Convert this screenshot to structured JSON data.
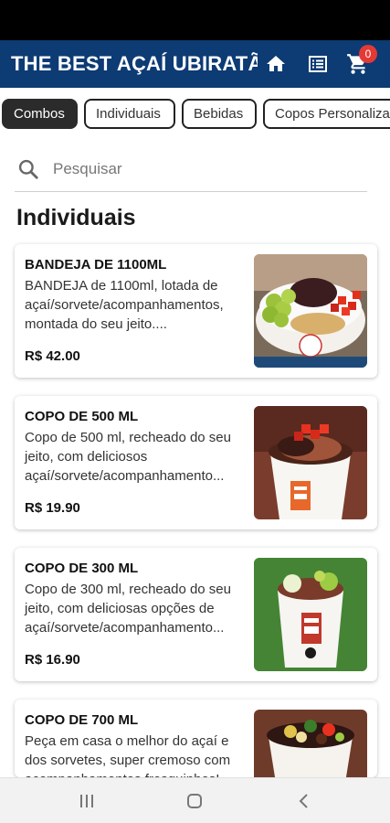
{
  "app": {
    "title": "THE BEST AÇAÍ UBIRATÃ"
  },
  "header": {
    "cart_count": "0"
  },
  "tabs": [
    {
      "label": "Combos",
      "active": true
    },
    {
      "label": "Individuais",
      "active": false
    },
    {
      "label": "Bebidas",
      "active": false
    },
    {
      "label": "Copos Personalizados",
      "active": false
    }
  ],
  "search": {
    "placeholder": "Pesquisar"
  },
  "section": {
    "title": "Individuais"
  },
  "products": [
    {
      "name": "BANDEJA DE 1100ML",
      "description": "BANDEJA de 1100ml, lotada de açaí/sorvete/acompanhamentos, montada do seu jeito....",
      "price": "R$ 42.00",
      "image": "tray-bowl"
    },
    {
      "name": "COPO DE 500 ML",
      "description": "Copo de 500 ml, recheado do seu jeito, com deliciosos açaí/sorvete/acompanhamento...",
      "price": "R$ 19.90",
      "image": "cup-500"
    },
    {
      "name": "COPO DE 300 ML",
      "description": "Copo de 300 ml, recheado do seu jeito, com deliciosas opções de açaí/sorvete/acompanhamento...",
      "price": "R$ 16.90",
      "image": "cup-300"
    },
    {
      "name": "COPO DE 700 ML",
      "description": "Peça em casa o melhor do açaí e dos sorvetes, super cremoso com acompanhamentos fresquinhos!",
      "price": "",
      "image": "cup-700"
    }
  ],
  "colors": {
    "appbar": "#0d3b74",
    "badge": "#e53935",
    "active_tab": "#2b2b2b"
  },
  "icons": [
    "home-icon",
    "menu-list-icon",
    "cart-icon",
    "search-icon",
    "recent-apps-icon",
    "home-nav-icon",
    "back-icon"
  ]
}
